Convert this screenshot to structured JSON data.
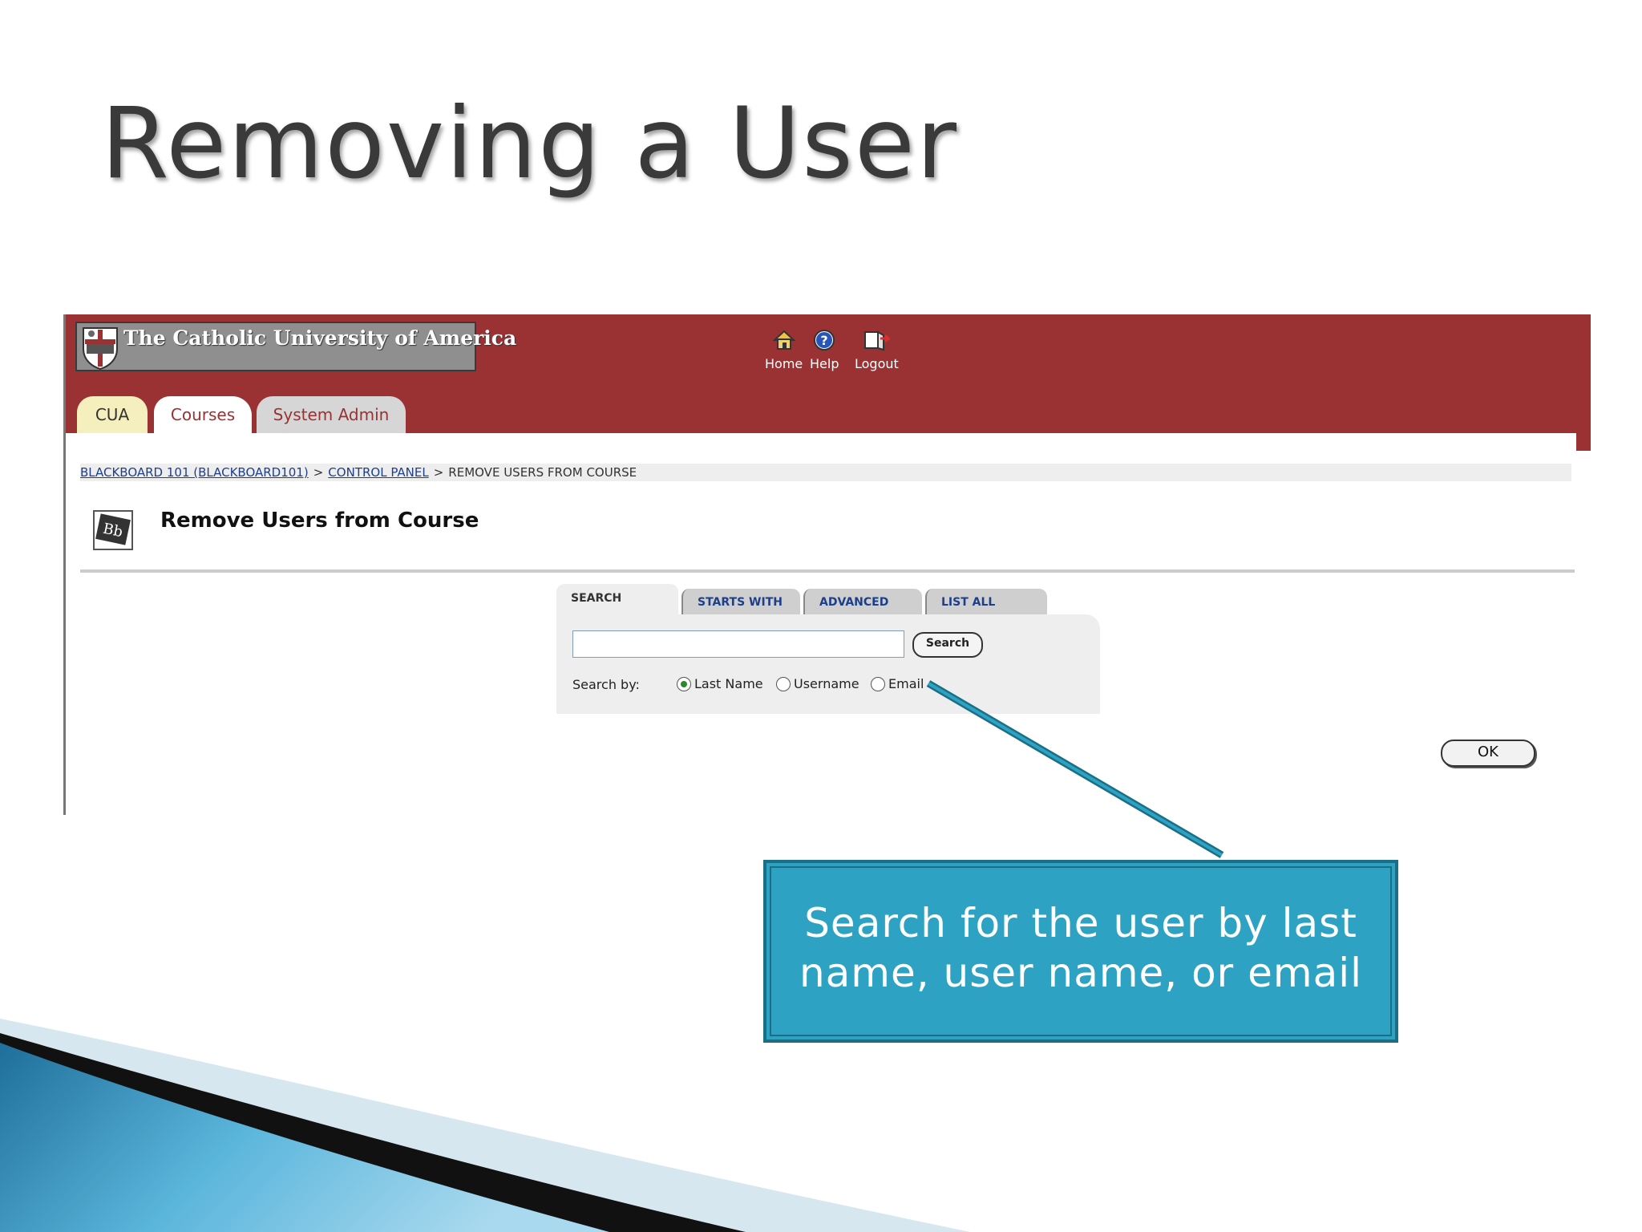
{
  "slide": {
    "title": "Removing a User"
  },
  "header": {
    "university_name": "The Catholic University of America",
    "nav": {
      "home": "Home",
      "help": "Help",
      "logout": "Logout"
    },
    "tabs": {
      "cua": "CUA",
      "courses": "Courses",
      "system_admin": "System Admin"
    }
  },
  "breadcrumb": {
    "course": "BLACKBOARD 101 (BLACKBOARD101)",
    "control_panel": "CONTROL PANEL",
    "current": "REMOVE USERS FROM COURSE",
    "separator": ">"
  },
  "page": {
    "heading": "Remove Users from Course",
    "icon_text": "Bb"
  },
  "search": {
    "tabs": {
      "search": "SEARCH",
      "starts_with": "STARTS WITH",
      "advanced": "ADVANCED",
      "list_all": "LIST ALL"
    },
    "input_value": "",
    "button_label": "Search",
    "search_by_label": "Search by:",
    "options": {
      "last_name": "Last Name",
      "username": "Username",
      "email": "Email"
    },
    "selected": "Last Name"
  },
  "actions": {
    "ok_label": "OK"
  },
  "callout": {
    "line1": "Search for the user by last",
    "line2": "name, user name, or email"
  },
  "colors": {
    "banner": "#9a3132",
    "callout": "#2ea2c3",
    "link": "#1d3f8a"
  }
}
